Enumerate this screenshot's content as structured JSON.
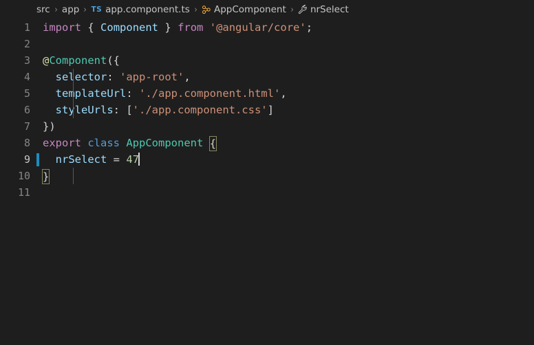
{
  "breadcrumb": {
    "items": [
      {
        "label": "src",
        "icon": null
      },
      {
        "label": "app",
        "icon": null
      },
      {
        "label": "app.component.ts",
        "icon": "typescript-file-icon"
      },
      {
        "label": "AppComponent",
        "icon": "class-symbol-icon"
      },
      {
        "label": "nrSelect",
        "icon": "property-symbol-icon"
      }
    ],
    "separator": "›",
    "ts_badge": "TS"
  },
  "editor": {
    "language": "typescript",
    "active_line": 9,
    "cursor_column_text": "47",
    "line_numbers": [
      "1",
      "2",
      "3",
      "4",
      "5",
      "6",
      "7",
      "8",
      "9",
      "10",
      "11"
    ],
    "lines": [
      {
        "number": "1",
        "tokens": [
          {
            "text": "import",
            "kind": "keyword"
          },
          {
            "text": " ",
            "kind": "plain"
          },
          {
            "text": "{",
            "kind": "punct"
          },
          {
            "text": " ",
            "kind": "plain"
          },
          {
            "text": "Component",
            "kind": "variable"
          },
          {
            "text": " ",
            "kind": "plain"
          },
          {
            "text": "}",
            "kind": "punct"
          },
          {
            "text": " ",
            "kind": "plain"
          },
          {
            "text": "from",
            "kind": "keyword"
          },
          {
            "text": " ",
            "kind": "plain"
          },
          {
            "text": "'@angular/core'",
            "kind": "string"
          },
          {
            "text": ";",
            "kind": "punct"
          }
        ]
      },
      {
        "number": "2",
        "tokens": []
      },
      {
        "number": "3",
        "tokens": [
          {
            "text": "@",
            "kind": "at"
          },
          {
            "text": "Component",
            "kind": "type"
          },
          {
            "text": "({",
            "kind": "punct"
          }
        ]
      },
      {
        "number": "4",
        "tokens": [
          {
            "text": "  ",
            "kind": "plain"
          },
          {
            "text": "selector",
            "kind": "variable"
          },
          {
            "text": ": ",
            "kind": "punct"
          },
          {
            "text": "'app-root'",
            "kind": "string"
          },
          {
            "text": ",",
            "kind": "punct"
          }
        ]
      },
      {
        "number": "5",
        "tokens": [
          {
            "text": "  ",
            "kind": "plain"
          },
          {
            "text": "templateUrl",
            "kind": "variable"
          },
          {
            "text": ": ",
            "kind": "punct"
          },
          {
            "text": "'./app.component.html'",
            "kind": "string"
          },
          {
            "text": ",",
            "kind": "punct"
          }
        ]
      },
      {
        "number": "6",
        "tokens": [
          {
            "text": "  ",
            "kind": "plain"
          },
          {
            "text": "styleUrls",
            "kind": "variable"
          },
          {
            "text": ": [",
            "kind": "punct"
          },
          {
            "text": "'./app.component.css'",
            "kind": "string"
          },
          {
            "text": "]",
            "kind": "punct"
          }
        ]
      },
      {
        "number": "7",
        "tokens": [
          {
            "text": "})",
            "kind": "punct"
          }
        ]
      },
      {
        "number": "8",
        "tokens": [
          {
            "text": "export",
            "kind": "keyword"
          },
          {
            "text": " ",
            "kind": "plain"
          },
          {
            "text": "class",
            "kind": "control"
          },
          {
            "text": " ",
            "kind": "plain"
          },
          {
            "text": "AppComponent",
            "kind": "type"
          },
          {
            "text": " ",
            "kind": "plain"
          },
          {
            "text": "{",
            "kind": "bracket-match"
          }
        ]
      },
      {
        "number": "9",
        "tokens": [
          {
            "text": "  ",
            "kind": "plain"
          },
          {
            "text": "nrSelect",
            "kind": "variable"
          },
          {
            "text": " ",
            "kind": "plain"
          },
          {
            "text": "=",
            "kind": "punct"
          },
          {
            "text": " ",
            "kind": "plain"
          },
          {
            "text": "47",
            "kind": "number"
          },
          {
            "text": "",
            "kind": "cursor"
          }
        ]
      },
      {
        "number": "10",
        "tokens": [
          {
            "text": "}",
            "kind": "bracket-match"
          }
        ]
      },
      {
        "number": "11",
        "tokens": []
      }
    ]
  },
  "colors": {
    "background": "#1e1e1e",
    "foreground": "#d4d4d4",
    "keyword": "#c586c0",
    "control": "#569cd6",
    "variable": "#9cdcfe",
    "type": "#4ec9b0",
    "string": "#ce9178",
    "number": "#b5cea8",
    "line_number": "#858585",
    "line_number_active": "#c6c6c6",
    "cursor_marker": "#1d8cbf",
    "breadcrumb_text": "#c5c5c5",
    "ts_badge": "#4a9fd8",
    "class_icon": "#e8a33d"
  }
}
